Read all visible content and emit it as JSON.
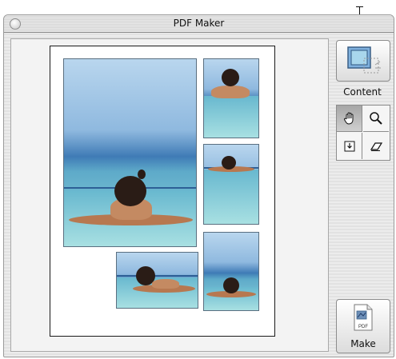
{
  "window": {
    "title": "PDF Maker"
  },
  "toolbar": {
    "content_label": "Content",
    "make_label": "Make",
    "make_icon_text": "PDF"
  },
  "tools": [
    {
      "name": "hand-tool",
      "icon": "hand-icon",
      "active": true
    },
    {
      "name": "zoom-tool",
      "icon": "magnifier-icon",
      "active": false
    },
    {
      "name": "insert-tool",
      "icon": "insert-icon",
      "active": false
    },
    {
      "name": "eraser-tool",
      "icon": "eraser-icon",
      "active": false
    }
  ],
  "document": {
    "photos": [
      {
        "name": "photo-large"
      },
      {
        "name": "photo-top-right"
      },
      {
        "name": "photo-middle-right"
      },
      {
        "name": "photo-bottom-left"
      },
      {
        "name": "photo-bottom-right"
      }
    ]
  }
}
